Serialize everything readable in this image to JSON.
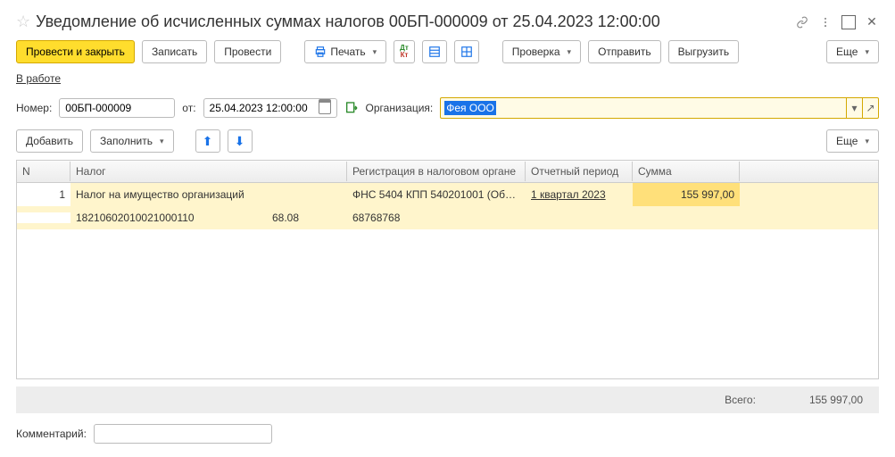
{
  "header": {
    "title": "Уведомление об исчисленных суммах налогов 00БП-000009 от 25.04.2023 12:00:00"
  },
  "toolbar": {
    "post_and_close": "Провести и закрыть",
    "save": "Записать",
    "post": "Провести",
    "print": "Печать",
    "check": "Проверка",
    "send": "Отправить",
    "export": "Выгрузить",
    "more": "Еще"
  },
  "status": "В работе",
  "fields": {
    "number_label": "Номер:",
    "number_value": "00БП-000009",
    "date_label": "от:",
    "date_value": "25.04.2023 12:00:00",
    "org_label": "Организация:",
    "org_value": "Фея ООО"
  },
  "sub_toolbar": {
    "add": "Добавить",
    "fill": "Заполнить",
    "more": "Еще"
  },
  "grid": {
    "cols": {
      "n": "N",
      "tax": "Налог",
      "reg": "Регистрация в налоговом органе",
      "period": "Отчетный период",
      "sum": "Сумма"
    },
    "rows": [
      {
        "n": "1",
        "tax_name": "Налог на имущество организаций",
        "tax_kbk": "18210602010021000110",
        "tax_code": "68.08",
        "reg_name": "ФНС 5404 КПП 540201001 (Об…",
        "reg_num": "68768768",
        "period": "1 квартал 2023",
        "sum": "155 997,00"
      }
    ]
  },
  "total": {
    "label": "Всего:",
    "value": "155 997,00"
  },
  "comment": {
    "label": "Комментарий:",
    "value": ""
  }
}
